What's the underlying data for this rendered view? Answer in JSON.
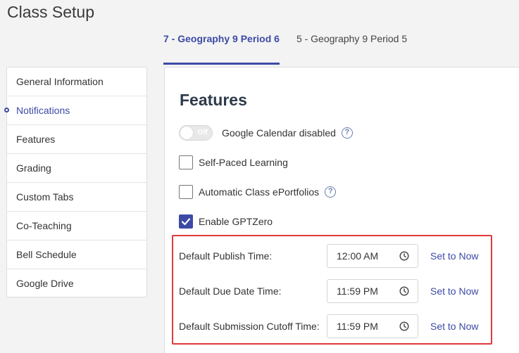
{
  "page": {
    "title": "Class Setup"
  },
  "tabs": [
    {
      "label": "7 - Geography 9 Period 6",
      "active": true
    },
    {
      "label": "5 - Geography 9 Period 5",
      "active": false
    }
  ],
  "sidebar": {
    "items": [
      {
        "label": "General Information"
      },
      {
        "label": "Notifications"
      },
      {
        "label": "Features"
      },
      {
        "label": "Grading"
      },
      {
        "label": "Custom Tabs"
      },
      {
        "label": "Co-Teaching"
      },
      {
        "label": "Bell Schedule"
      },
      {
        "label": "Google Drive"
      }
    ]
  },
  "features": {
    "title": "Features",
    "google_calendar": {
      "toggle_text": "Off",
      "label": "Google Calendar disabled"
    },
    "self_paced": {
      "label": "Self-Paced Learning",
      "checked": false
    },
    "eportfolios": {
      "label": "Automatic Class ePortfolios",
      "checked": false
    },
    "gptzero": {
      "label": "Enable GPTZero",
      "checked": true
    },
    "help_glyph": "?",
    "times": [
      {
        "label": "Default Publish Time:",
        "value": "12:00 AM",
        "action": "Set to Now"
      },
      {
        "label": "Default Due Date Time:",
        "value": "11:59 PM",
        "action": "Set to Now"
      },
      {
        "label": "Default Submission Cutoff Time:",
        "value": "11:59 PM",
        "action": "Set to Now"
      }
    ]
  },
  "colors": {
    "accent": "#3d4aa5",
    "highlight_border": "#e03a3a"
  }
}
